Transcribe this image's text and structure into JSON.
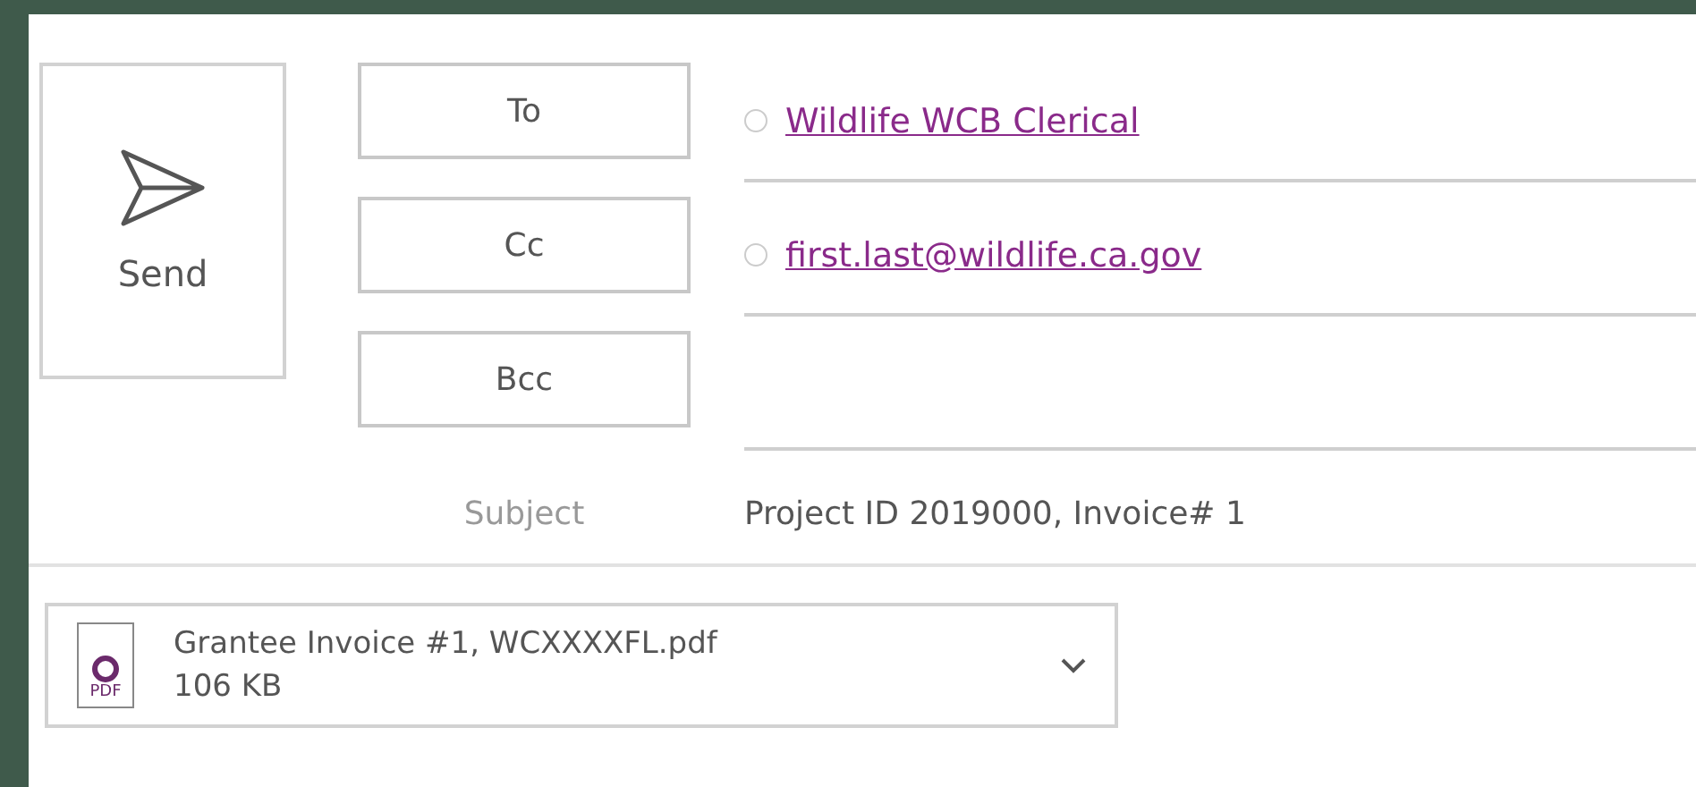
{
  "send_button": {
    "label": "Send"
  },
  "recipient_fields": [
    {
      "button": "To",
      "recipients": [
        "Wildlife WCB Clerical"
      ]
    },
    {
      "button": "Cc",
      "recipients": [
        "first.last@wildlife.ca.gov"
      ]
    },
    {
      "button": "Bcc"
    }
  ],
  "subject": {
    "label": "Subject",
    "value": "Project ID 2019000, Invoice# 1"
  },
  "attachment": {
    "file_name": "Grantee Invoice #1, WCXXXXFL.pdf",
    "size": "106 KB",
    "icon_label": "PDF"
  }
}
